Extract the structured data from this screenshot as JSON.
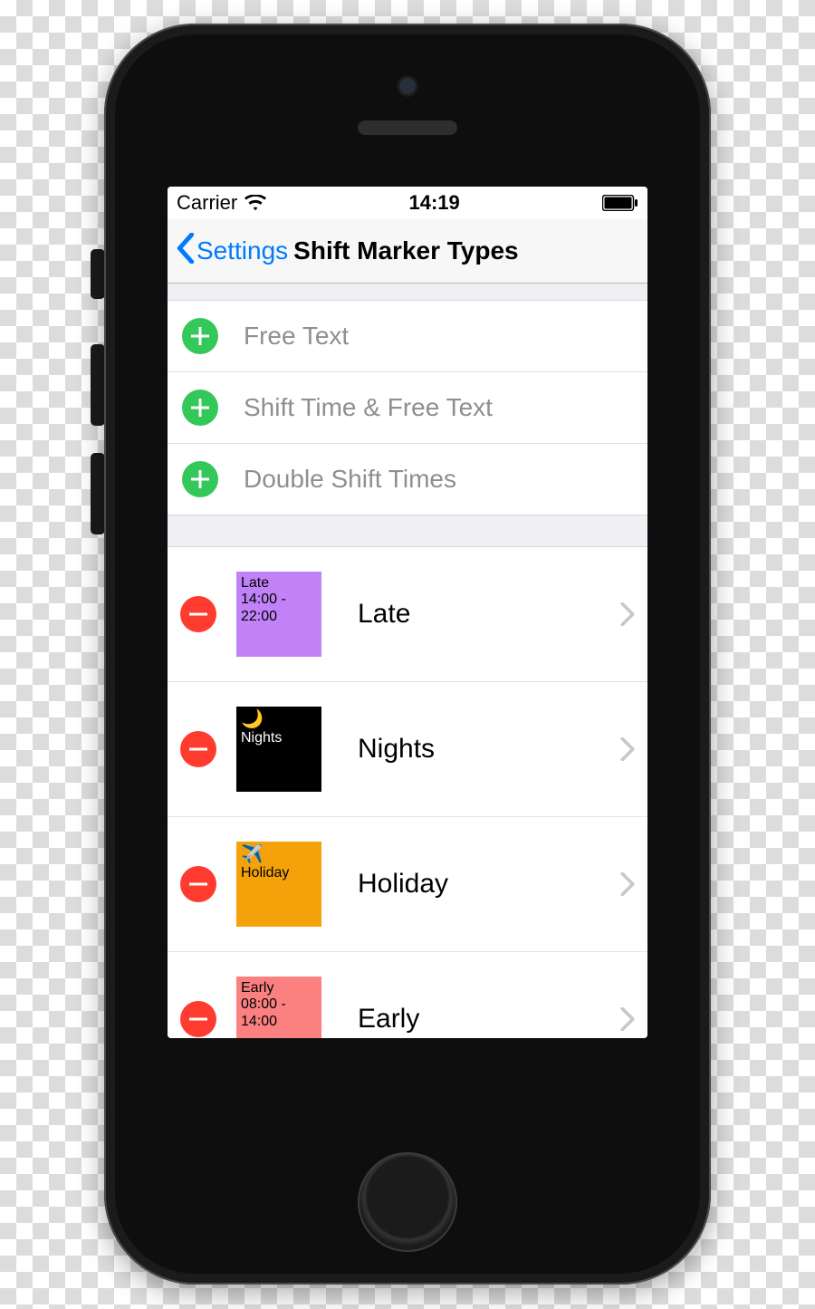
{
  "statusbar": {
    "carrier": "Carrier",
    "time": "14:19"
  },
  "navbar": {
    "back_label": "Settings",
    "title": "Shift Marker Types"
  },
  "add_options": [
    {
      "label": "Free Text"
    },
    {
      "label": "Shift Time & Free Text"
    },
    {
      "label": "Double Shift Times"
    }
  ],
  "markers": [
    {
      "name": "Late",
      "thumb_bg": "#c082f6",
      "thumb_text_color": "#000000",
      "thumb_line1": "Late",
      "thumb_line2": "14:00 -",
      "thumb_line3": "22:00",
      "thumb_icon": ""
    },
    {
      "name": "Nights",
      "thumb_bg": "#000000",
      "thumb_text_color": "#ffffff",
      "thumb_line1": "Nights",
      "thumb_line2": "",
      "thumb_line3": "",
      "thumb_icon": "🌙"
    },
    {
      "name": "Holiday",
      "thumb_bg": "#f5a20a",
      "thumb_text_color": "#000000",
      "thumb_line1": "Holiday",
      "thumb_line2": "",
      "thumb_line3": "",
      "thumb_icon": "✈️"
    },
    {
      "name": "Early",
      "thumb_bg": "#fb8080",
      "thumb_text_color": "#000000",
      "thumb_line1": "Early",
      "thumb_line2": "08:00 -",
      "thumb_line3": "14:00",
      "thumb_icon": ""
    }
  ]
}
